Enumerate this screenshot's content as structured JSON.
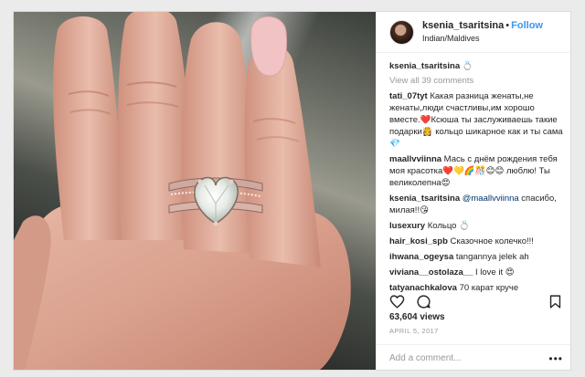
{
  "post": {
    "username": "ksenia_tsaritsina",
    "separator": "•",
    "follow_label": "Follow",
    "location": "Indian/Maldives"
  },
  "caption": {
    "username": "ksenia_tsaritsina",
    "text": "💍"
  },
  "view_all_label": "View all 39 comments",
  "comments": [
    {
      "username": "tati_07tyt",
      "text": "Какая разница женаты,не женаты,люди счастливы,им хорошо вместе.❤️Ксюша ты заслуживаешь такие подарки👸 кольцо шикарное как и ты сама💎"
    },
    {
      "username": "maallvviinna",
      "text": "Мась с днём рождения тебя моя красотка❤️💛🌈🎊😊😊 люблю! Ты великолепна😍"
    },
    {
      "username": "ksenia_tsaritsina",
      "mention": "@maallvviinna",
      "text": " спасибо, милая!!😘"
    },
    {
      "username": "lusexury",
      "text": "Кольцо 💍"
    },
    {
      "username": "hair_kosi_spb",
      "text": "Сказочное колечко!!!"
    },
    {
      "username": "ihwana_ogeysa",
      "text": "tangannya jelek ah"
    },
    {
      "username": "viviana__ostolaza__",
      "text": "I love it 😍"
    },
    {
      "username": "tatyanachkalova",
      "text": "70 карат круче"
    }
  ],
  "stats": {
    "views": "63,604 views",
    "date": "APRIL 5, 2017"
  },
  "add_comment": {
    "placeholder": "Add a comment...",
    "more_label": "•••"
  },
  "icons": {
    "like": "heart-icon",
    "comment": "comment-icon",
    "save": "bookmark-icon"
  },
  "colors": {
    "accent": "#3897f0",
    "text": "#262626",
    "muted": "#999999"
  }
}
